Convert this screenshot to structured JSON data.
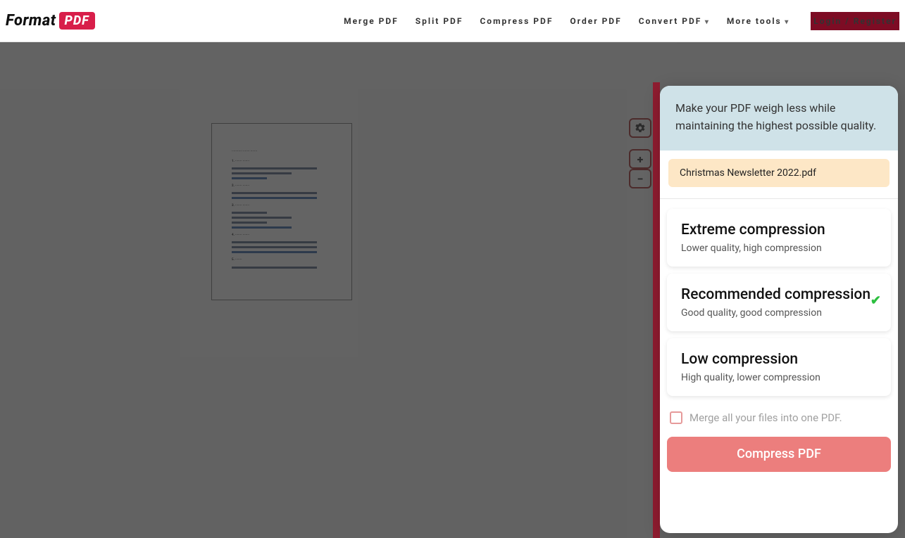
{
  "brand": {
    "text": "Format",
    "badge": "PDF"
  },
  "nav": {
    "merge": "Merge PDF",
    "split": "Split PDF",
    "compress": "Compress PDF",
    "order": "Order PDF",
    "convert": "Convert PDF",
    "more": "More tools",
    "login": "Login / Register"
  },
  "toolbar": {
    "plus": "+",
    "minus": "−"
  },
  "panel": {
    "intro": "Make your PDF weigh less while maintaining the highest possible quality.",
    "filename": "Christmas Newsletter 2022.pdf",
    "options": [
      {
        "title": "Extreme compression",
        "desc": "Lower quality, high compression",
        "selected": false
      },
      {
        "title": "Recommended compression",
        "desc": "Good quality, good compression",
        "selected": true
      },
      {
        "title": "Low compression",
        "desc": "High quality, lower compression",
        "selected": false
      }
    ],
    "merge_label": "Merge all your files into one PDF.",
    "action": "Compress PDF"
  }
}
